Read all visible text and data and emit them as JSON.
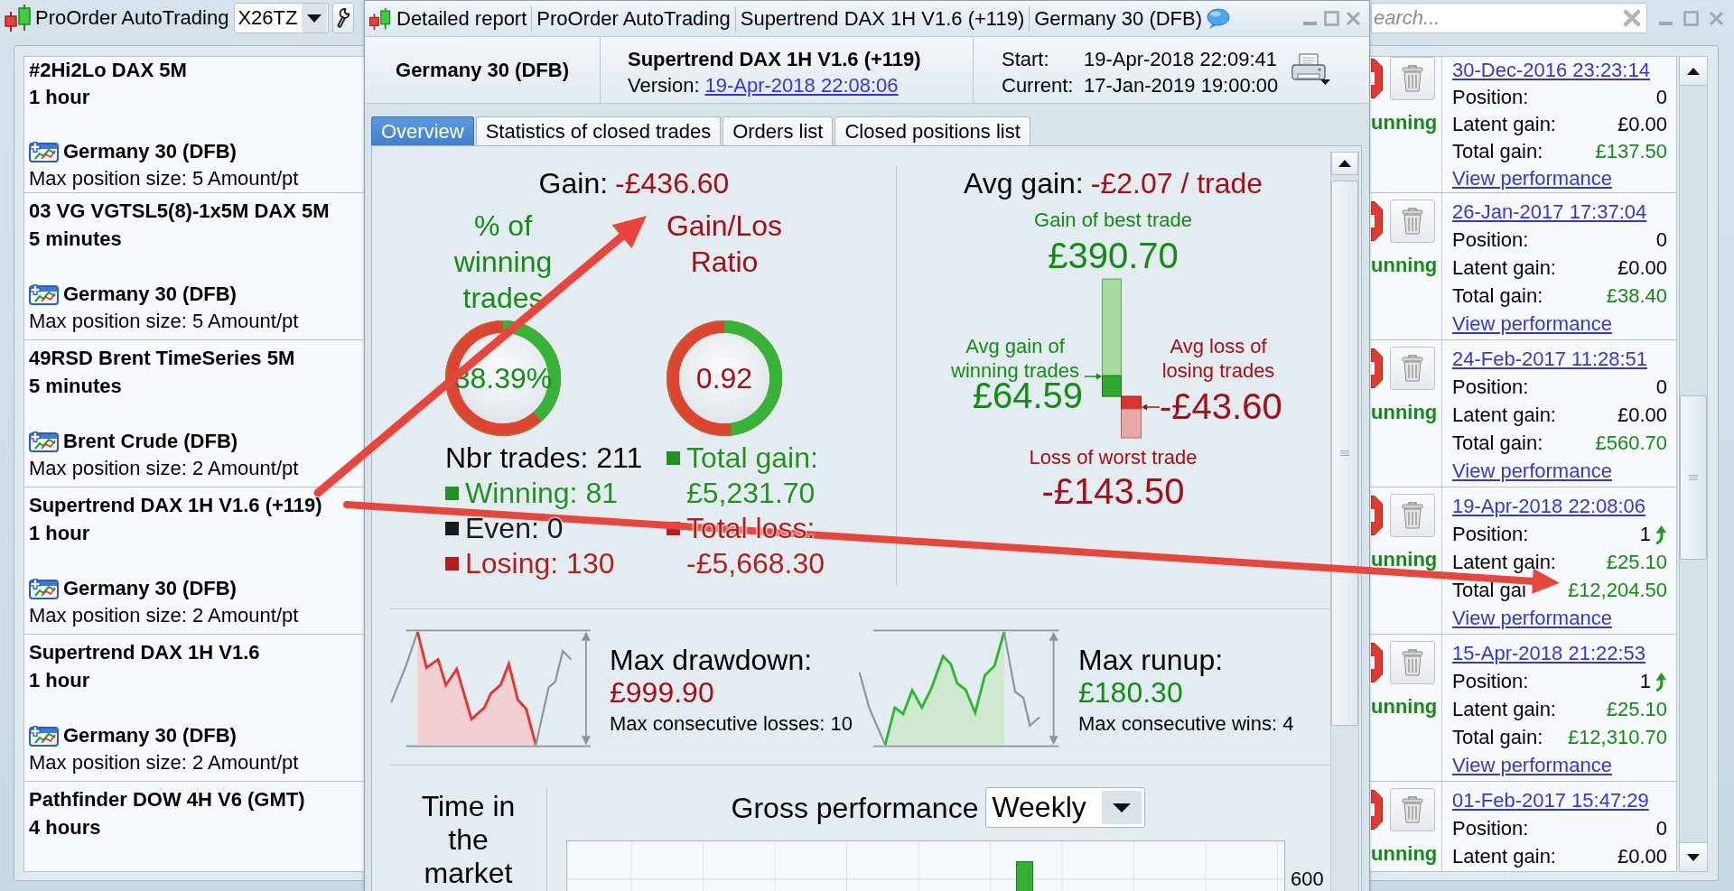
{
  "app": {
    "title": "ProOrder AutoTrading",
    "account": "X26TZ",
    "search": {
      "placeholder": "earch..."
    }
  },
  "systems": [
    {
      "strategy": "#2Hi2Lo DAX 5M",
      "timeframe": "1 hour",
      "instrument": "Germany 30 (DFB)",
      "max_position": "Max position size: 5 Amount/pt",
      "status": "unning",
      "started": "30-Dec-2016 23:23:14",
      "position": {
        "label": "Position:",
        "value": "0",
        "long": false
      },
      "latent_gain": {
        "label": "Latent gain:",
        "value": "£0.00",
        "color": "#000000"
      },
      "total_gain": {
        "label": "Total gain:",
        "value": "£137.50"
      },
      "link": "View performance"
    },
    {
      "strategy": "03 VG VGTSL5(8)-1x5M DAX 5M",
      "timeframe": "5 minutes",
      "instrument": "Germany 30 (DFB)",
      "max_position": "Max position size: 5 Amount/pt",
      "status": "unning",
      "started": "26-Jan-2017 17:37:04",
      "position": {
        "label": "Position:",
        "value": "0",
        "long": false
      },
      "latent_gain": {
        "label": "Latent gain:",
        "value": "£0.00",
        "color": "#000000"
      },
      "total_gain": {
        "label": "Total gain:",
        "value": "£38.40"
      },
      "link": "View performance"
    },
    {
      "strategy": "49RSD Brent TimeSeries 5M",
      "timeframe": "5 minutes",
      "instrument": "Brent Crude (DFB)",
      "max_position": "Max position size: 2 Amount/pt",
      "status": "unning",
      "started": "24-Feb-2017 11:28:51",
      "position": {
        "label": "Position:",
        "value": "0",
        "long": false
      },
      "latent_gain": {
        "label": "Latent gain:",
        "value": "£0.00",
        "color": "#000000"
      },
      "total_gain": {
        "label": "Total gain:",
        "value": "£560.70"
      },
      "link": "View performance"
    },
    {
      "strategy": "Supertrend DAX 1H V1.6 (+119)",
      "timeframe": "1 hour",
      "instrument": "Germany 30 (DFB)",
      "max_position": "Max position size: 2 Amount/pt",
      "status": "unning",
      "started": "19-Apr-2018 22:08:06",
      "position": {
        "label": "Position:",
        "value": "1",
        "long": true
      },
      "latent_gain": {
        "label": "Latent gain:",
        "value": "£25.10",
        "color": "#148c14"
      },
      "total_gain": {
        "label": "Total gai",
        "value": "£12,204.50"
      },
      "link": "View performance"
    },
    {
      "strategy": "Supertrend DAX 1H V1.6",
      "timeframe": "1 hour",
      "instrument": "Germany 30 (DFB)",
      "max_position": "Max position size: 2 Amount/pt",
      "status": "unning",
      "started": "15-Apr-2018 21:22:53",
      "position": {
        "label": "Position:",
        "value": "1",
        "long": true
      },
      "latent_gain": {
        "label": "Latent gain:",
        "value": "£25.10",
        "color": "#148c14"
      },
      "total_gain": {
        "label": "Total gain:",
        "value": "£12,310.70"
      },
      "link": "View performance"
    },
    {
      "strategy": "Pathfinder DOW 4H V6 (GMT)",
      "timeframe": "4 hours",
      "status": "unning",
      "started": "01-Feb-2017 15:47:29",
      "position": {
        "label": "Position:",
        "value": "0",
        "long": false
      },
      "latent_gain": {
        "label": "Latent gain:",
        "value": "£0.00",
        "color": "#000000"
      }
    }
  ],
  "report": {
    "title_segments": [
      "Detailed report",
      "ProOrder AutoTrading",
      "Supertrend DAX 1H V1.6 (+119)",
      "Germany 30 (DFB)"
    ],
    "instrument": "Germany 30 (DFB)",
    "system": "Supertrend DAX 1H V1.6 (+119)",
    "version": {
      "label": "Version:",
      "value": "19-Apr-2018 22:08:06"
    },
    "dates": [
      {
        "label": "Start:",
        "value": "19-Apr-2018 22:09:41"
      },
      {
        "label": "Current:",
        "value": "17-Jan-2019 19:00:00"
      }
    ],
    "tabs": [
      {
        "label": "Overview",
        "selected": true
      },
      {
        "label": "Statistics of closed trades",
        "selected": false
      },
      {
        "label": "Orders list",
        "selected": false
      },
      {
        "label": "Closed positions list",
        "selected": false
      }
    ],
    "overview": {
      "gain": {
        "label": "Gain:",
        "value": "-£436.60"
      },
      "rings": [
        {
          "title": "% of winning trades",
          "value": "38.39%",
          "level": 0.3839,
          "color": "#148c14",
          "legend": [
            {
              "kind": "plain",
              "text": "Nbr trades: 211",
              "color": "#000000"
            },
            {
              "kind": "swatch",
              "text": "Winning: 81",
              "color": "#1f921f"
            },
            {
              "kind": "swatch",
              "text": "Even: 0",
              "color": "#1a1a1a"
            },
            {
              "kind": "swatch",
              "text": "Losing: 130",
              "color": "#b51c1c"
            }
          ]
        },
        {
          "title": "Gain/Los Ratio",
          "value": "0.92",
          "level": 0.479,
          "color": "#a50e14",
          "legend": [
            {
              "kind": "swatch",
              "text": "Total gain:",
              "color": "#1f921f"
            },
            {
              "kind": "value",
              "text": "£5,231.70",
              "color": "#1f921f"
            },
            {
              "kind": "swatch",
              "text": "Total loss:",
              "color": "#b51c1c"
            },
            {
              "kind": "value",
              "text": "-£5,668.30",
              "color": "#b51c1c"
            }
          ]
        }
      ],
      "avg_gain": {
        "label": "Avg gain:",
        "value": "-£2.07 / trade"
      },
      "best_trade": {
        "label": "Gain of best trade",
        "value": "£390.70"
      },
      "avg_win": {
        "label": "Avg gain of winning trades",
        "value": "£64.59"
      },
      "avg_loss": {
        "label": "Avg loss of losing trades",
        "value": "-£43.60"
      },
      "worst_trade": {
        "label": "Loss of worst trade",
        "value": "-£143.50"
      },
      "extremes": [
        {
          "kind": "drawdown",
          "label": "Max drawdown:",
          "value": "£999.90",
          "note": "Max consecutive losses: 10"
        },
        {
          "kind": "runup",
          "label": "Max runup:",
          "value": "£180.30",
          "note": "Max consecutive wins: 4"
        }
      ],
      "time_in_market": "Time in the market",
      "gross_performance": {
        "label": "Gross performance",
        "period": "Weekly",
        "axis_labels": [
          "600"
        ]
      }
    }
  }
}
